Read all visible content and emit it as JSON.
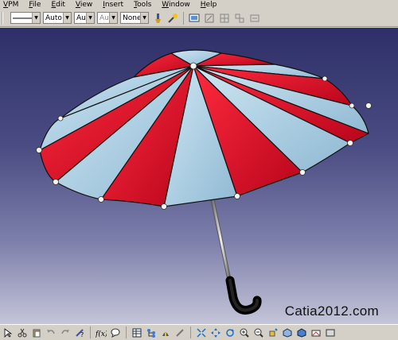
{
  "menu": {
    "items": [
      "VPM",
      "File",
      "Edit",
      "View",
      "Insert",
      "Tools",
      "Window",
      "Help"
    ]
  },
  "properties_toolbar": {
    "line_style_label": "",
    "line_weight": "Auto",
    "line_type": "Aut",
    "layer_disabled": "Aut",
    "layer": "None"
  },
  "watermark": "Catia2012.com",
  "colors": {
    "canopy_red": "#e0102a",
    "canopy_light": "#a9d2e8",
    "background_top": "#2e2f68",
    "background_bottom": "#c4c5d8",
    "handle": "#111111"
  },
  "icons": {
    "toolbar": [
      "paintbrush-icon",
      "apply-format-icon",
      "screen-lock-icon",
      "snap-icon",
      "sketch-grid-icon",
      "group-icon",
      "ungroup-icon"
    ],
    "bottom": [
      "select-icon",
      "cut-icon",
      "paste-icon",
      "undo-icon",
      "redo-icon",
      "help-icon",
      "formula-icon",
      "comment-icon",
      "table-icon",
      "tree-icon",
      "measure-icon",
      "fly-icon",
      "fit-all-icon",
      "pan-icon",
      "rotate-icon",
      "zoom-in-icon",
      "zoom-out-icon",
      "normal-view-icon",
      "iso-view-icon",
      "render-icon",
      "hide-show-icon",
      "swap-icon"
    ]
  }
}
